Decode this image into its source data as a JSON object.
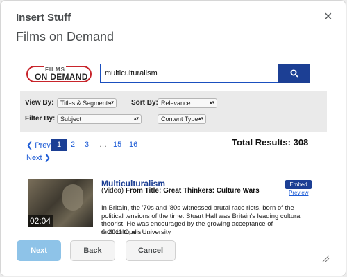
{
  "dialog": {
    "title": "Insert Stuff",
    "heading": "Films on Demand"
  },
  "logo": {
    "top": "FILMS",
    "bottom": "ON DEMAND"
  },
  "search": {
    "value": "multiculturalism"
  },
  "filters": {
    "view_by_label": "View By:",
    "view_by_value": "Titles & Segments",
    "sort_by_label": "Sort By:",
    "sort_by_value": "Relevance",
    "filter_by_label": "Filter By:",
    "filter_by_value": "Subject",
    "content_type_value": "Content Type"
  },
  "pagination": {
    "prev": "Prev",
    "pages": [
      "1",
      "2",
      "3",
      "…",
      "15",
      "16"
    ],
    "next": "Next",
    "total": "Total Results: 308"
  },
  "result": {
    "duration": "02:04",
    "title": "Multiculturalism",
    "type_prefix": "(Video)",
    "from_title": "From Title: Great Thinkers: Culture Wars",
    "description": "In Britain, the '70s and '80s witnessed brutal race riots, born of the political tensions of the time. Stuart Hall was Britain's leading cultural theorist. He was encouraged by the growing acceptance of multiculturalism.",
    "copyright": "© 2011 Open University",
    "embed": "Embed",
    "preview": "Preview"
  },
  "footer": {
    "next": "Next",
    "back": "Back",
    "cancel": "Cancel"
  },
  "icons": {
    "close": "close-icon",
    "search": "search-icon",
    "resize": "resize-handle-icon"
  },
  "colors": {
    "primary": "#1c3f94",
    "link": "#1c5bd6",
    "next_button": "#8ec3e8",
    "logo_red": "#c8242b"
  }
}
